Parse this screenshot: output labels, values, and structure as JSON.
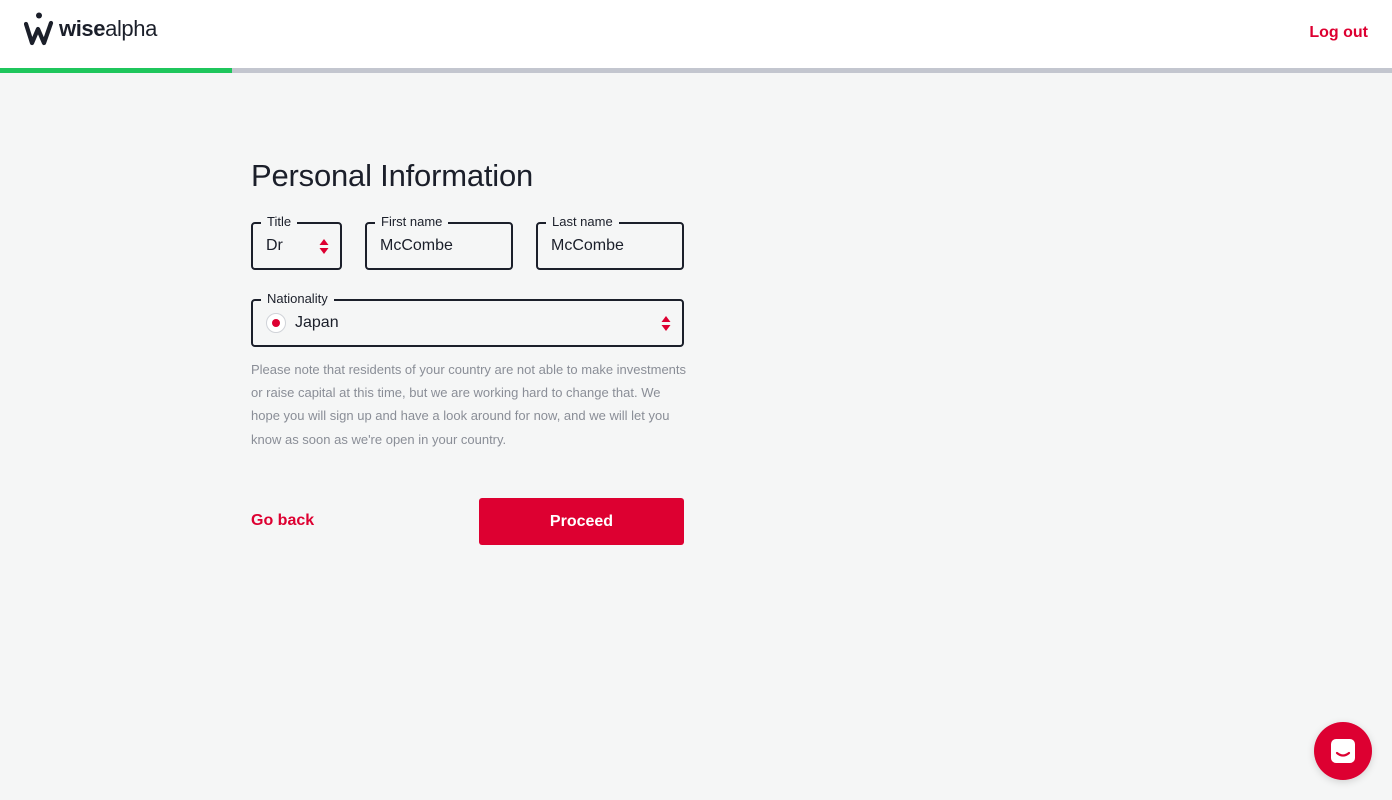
{
  "header": {
    "brand_bold": "wise",
    "brand_light": "alpha",
    "logout_label": "Log out"
  },
  "progress": {
    "fraction": 0.167,
    "fill_color": "#1fc65c",
    "track_color": "#c3c6cf"
  },
  "form": {
    "title": "Personal Information",
    "fields": {
      "title": {
        "label": "Title",
        "value": "Dr"
      },
      "first_name": {
        "label": "First name",
        "value": "McCombe"
      },
      "last_name": {
        "label": "Last name",
        "value": "McCombe"
      },
      "nationality": {
        "label": "Nationality",
        "value": "Japan",
        "flag_icon": "japan-flag-icon"
      }
    },
    "notice": "Please note that residents of your country are not able to make investments or raise capital at this time, but we are working hard to change that. We hope you will sign up and have a look around for now, and we will let you know as soon as we're open in your country.",
    "go_back_label": "Go back",
    "proceed_label": "Proceed"
  },
  "chat": {
    "icon": "chat-icon"
  },
  "colors": {
    "accent": "#dd0031",
    "text": "#1b1f2a",
    "muted": "#8a8e97",
    "background": "#f5f6f6"
  }
}
